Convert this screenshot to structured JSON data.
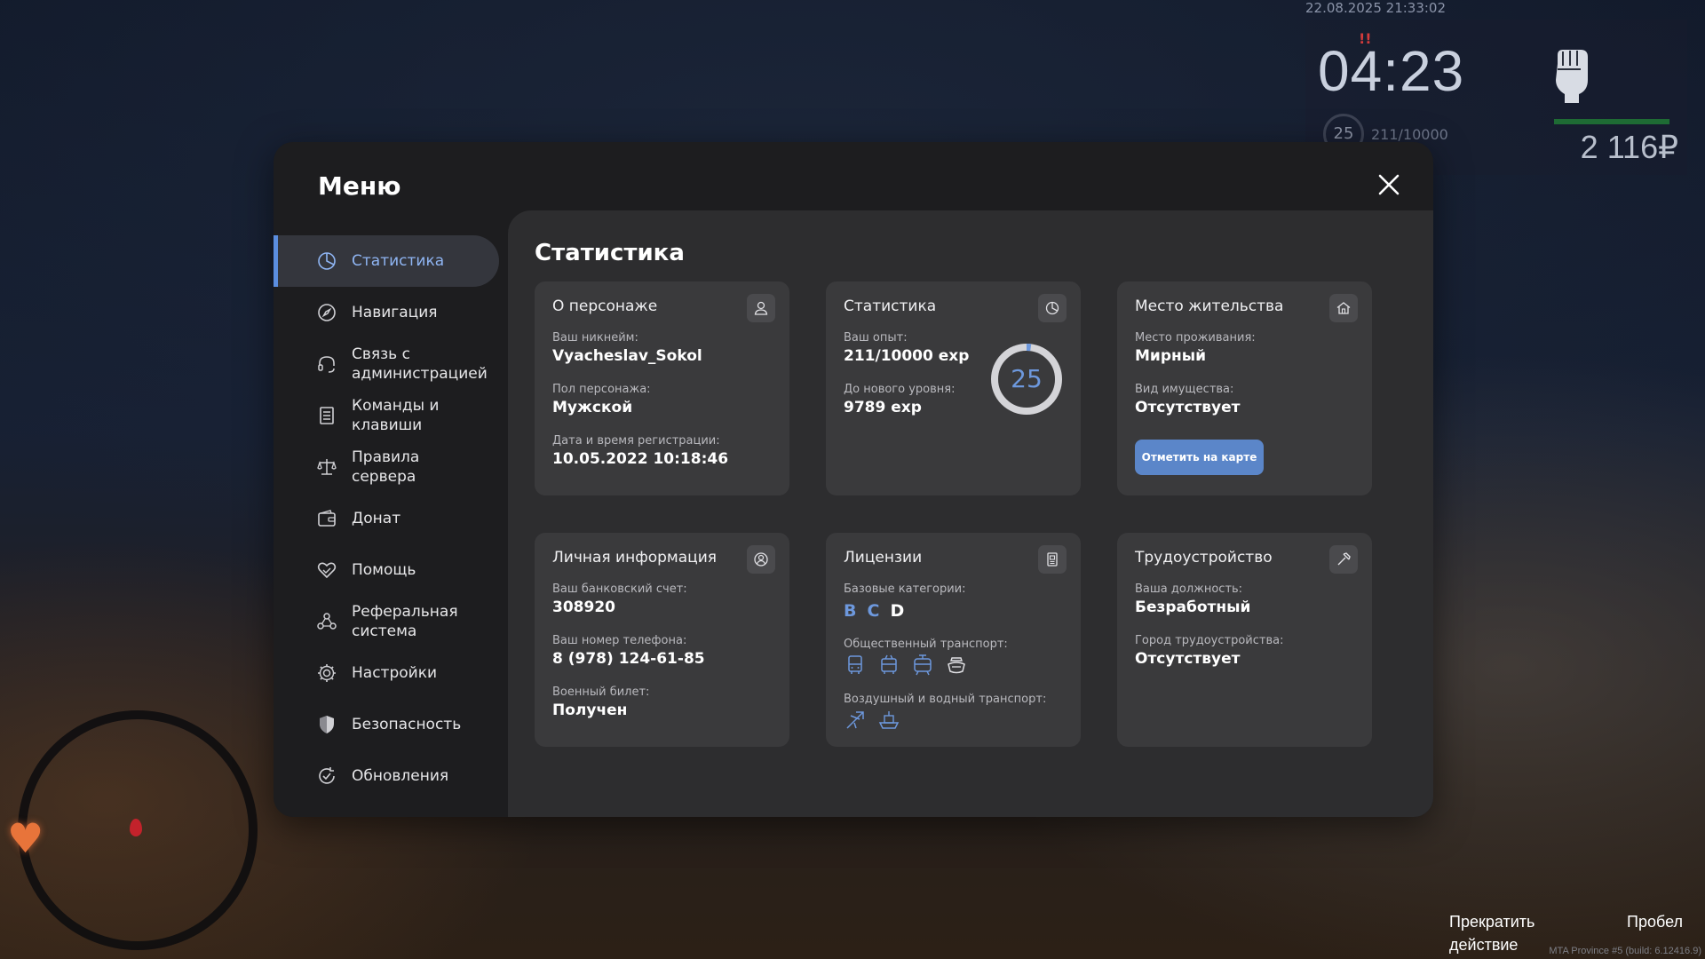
{
  "hud": {
    "datetime": "22.08.2025 21:33:02",
    "clock": "04:23",
    "wanted": "!!",
    "level": "25",
    "exp": "211/10000",
    "money": "2 116₽",
    "fist_icon": "fist-icon"
  },
  "hints": {
    "cancel": "Прекратить действие",
    "key": "Пробел"
  },
  "build": "MTA Province #5 (build: 6.12416.9)",
  "menu": {
    "title": "Меню",
    "close_icon": "close-icon"
  },
  "sidebar": {
    "items": [
      {
        "label": "Статистика",
        "icon": "pie-chart-icon",
        "active": true
      },
      {
        "label": "Навигация",
        "icon": "compass-icon"
      },
      {
        "label": "Связь с администрацией",
        "icon": "headset-icon"
      },
      {
        "label": "Команды и клавиши",
        "icon": "document-list-icon"
      },
      {
        "label": "Правила сервера",
        "icon": "scales-icon"
      },
      {
        "label": "Донат",
        "icon": "wallet-icon"
      },
      {
        "label": "Помощь",
        "icon": "heart-handshake-icon"
      },
      {
        "label": "Реферальная система",
        "icon": "people-network-icon"
      },
      {
        "label": "Настройки",
        "icon": "gear-icon"
      },
      {
        "label": "Безопасность",
        "icon": "shield-icon"
      },
      {
        "label": "Обновления",
        "icon": "refresh-check-icon"
      }
    ]
  },
  "content": {
    "title": "Статистика"
  },
  "cards": {
    "character": {
      "title": "О персонаже",
      "icon": "user-icon",
      "nickname_label": "Ваш никнейм:",
      "nickname": "Vyacheslav_Sokol",
      "gender_label": "Пол персонажа:",
      "gender": "Мужской",
      "reg_label": "Дата и время регистрации:",
      "reg": "10.05.2022 10:18:46"
    },
    "stats": {
      "title": "Статистика",
      "icon": "pie-chart-icon",
      "exp_label": "Ваш опыт:",
      "exp": "211/10000 exp",
      "next_label": "До нового уровня:",
      "next": "9789 exp",
      "level": "25",
      "progress": 0.0211,
      "ring_color": "#6d98dd"
    },
    "residence": {
      "title": "Место жительства",
      "icon": "house-icon",
      "place_label": "Место проживания:",
      "place": "Мирный",
      "property_label": "Вид имущества:",
      "property": "Отсутствует",
      "button": "Отметить на карте"
    },
    "personal": {
      "title": "Личная информация",
      "icon": "user-circle-icon",
      "bank_label": "Ваш банковский счет:",
      "bank": "308920",
      "phone_label": "Ваш номер телефона:",
      "phone": "8 (978) 124-61-85",
      "military_label": "Военный билет:",
      "military": "Получен"
    },
    "licenses": {
      "title": "Лицензии",
      "icon": "license-card-icon",
      "base_label": "Базовые категории:",
      "categories": [
        {
          "name": "B",
          "owned": false
        },
        {
          "name": "C",
          "owned": false
        },
        {
          "name": "D",
          "owned": true
        }
      ],
      "public_label": "Общественный транспорт:",
      "public_icons": [
        "bus-icon",
        "trolleybus-icon",
        "tram-icon",
        "taxi-icon"
      ],
      "air_label": "Воздушный и водный транспорт:",
      "air_icons": [
        "plane-icon",
        "boat-icon"
      ]
    },
    "employment": {
      "title": "Трудоустройство",
      "icon": "hammer-icon",
      "position_label": "Ваша должность:",
      "position": "Безработный",
      "city_label": "Город трудоустройства:",
      "city": "Отсутствует"
    }
  },
  "colors": {
    "accent": "#5b8ee0",
    "button": "#5b86c9",
    "card": "#3a3a3c"
  }
}
